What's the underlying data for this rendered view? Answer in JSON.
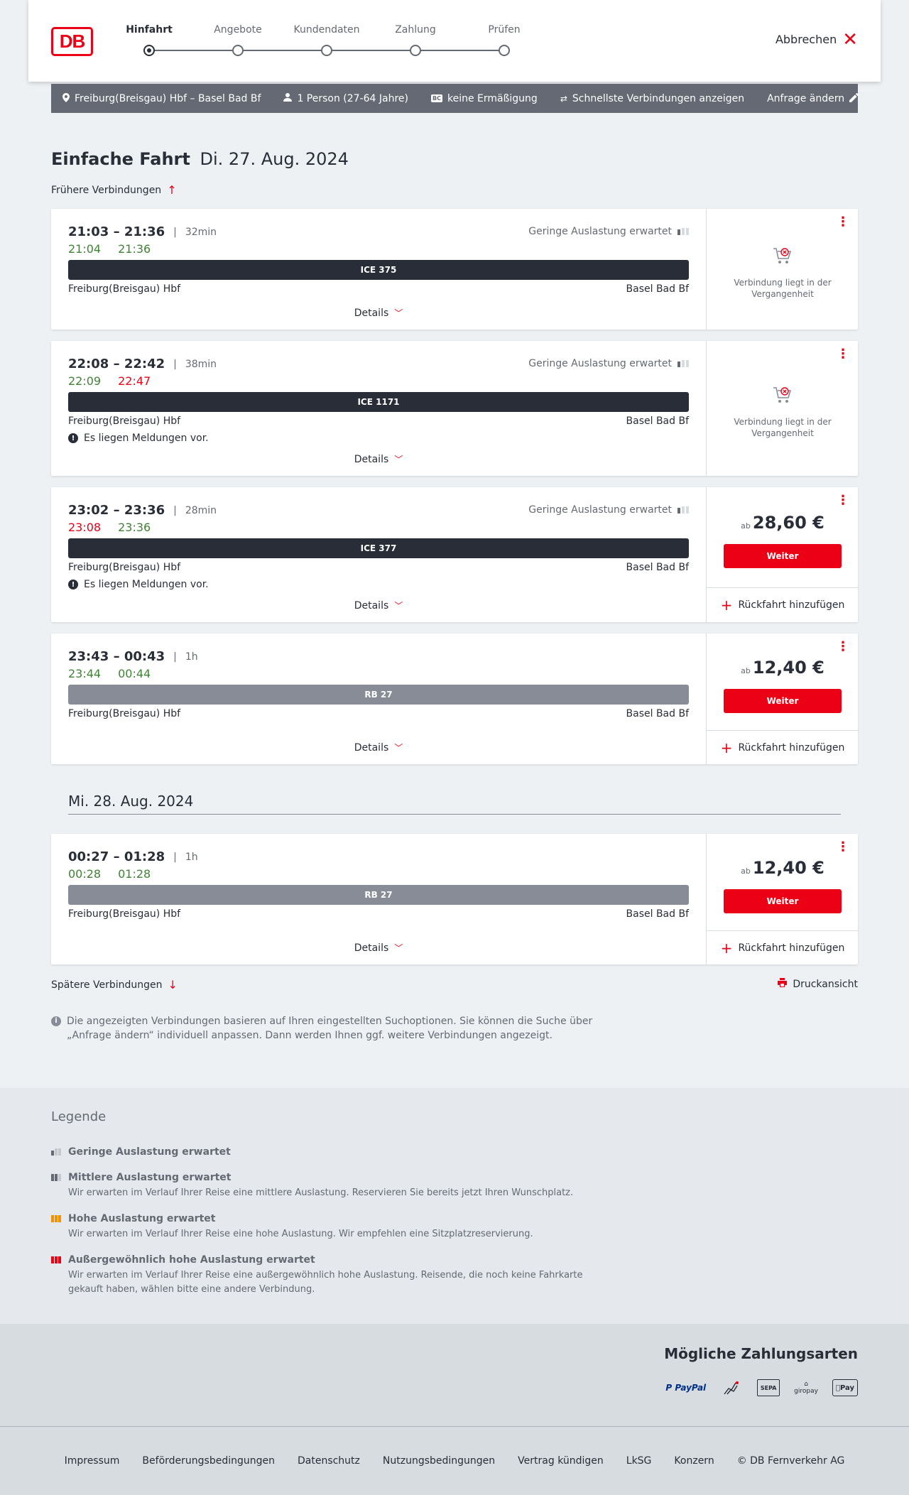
{
  "header": {
    "logo_text": "DB",
    "steps": [
      {
        "label": "Hinfahrt",
        "active": true
      },
      {
        "label": "Angebote",
        "active": false
      },
      {
        "label": "Kundendaten",
        "active": false
      },
      {
        "label": "Zahlung",
        "active": false
      },
      {
        "label": "Prüfen",
        "active": false
      }
    ],
    "cancel_label": "Abbrechen"
  },
  "searchbar": {
    "route": "Freiburg(Breisgau) Hbf – Basel Bad Bf",
    "travellers": "1 Person (27-64 Jahre)",
    "discount": "keine Ermäßigung",
    "fastest": "Schnellste Verbindungen anzeigen",
    "edit": "Anfrage ändern",
    "discount_badge": "BC"
  },
  "page": {
    "title_bold": "Einfache Fahrt",
    "title_date": "Di. 27. Aug. 2024",
    "earlier": "Frühere Verbindungen",
    "later": "Spätere Verbindungen",
    "print": "Druckansicht",
    "day2": "Mi. 28. Aug. 2024",
    "info_note": "Die angezeigten Verbindungen basieren auf Ihren eingestellten Suchoptionen. Sie können die Suche über „Anfrage ändern“ individuell anpassen. Dann werden Ihnen ggf. weitere Verbindungen angezeigt."
  },
  "common": {
    "load_low": "Geringe Auslastung erwartet",
    "details": "Details",
    "messages": "Es liegen Meldungen vor.",
    "past": "Verbindung liegt in der Vergangenheit",
    "ab": "ab",
    "weiter": "Weiter",
    "return": "Rückfahrt hinzufügen",
    "from": "Freiburg(Breisgau) Hbf",
    "to": "Basel Bad Bf"
  },
  "connections": [
    {
      "times": "21:03 – 21:36",
      "duration": "32min",
      "rt_dep": "21:04",
      "rt_arr": "21:36",
      "train": "ICE 375"
    },
    {
      "times": "22:08 – 22:42",
      "duration": "38min",
      "rt_dep": "22:09",
      "rt_arr": "22:47",
      "train": "ICE 1171"
    },
    {
      "times": "23:02 – 23:36",
      "duration": "28min",
      "rt_dep": "23:08",
      "rt_arr": "23:36",
      "train": "ICE 377",
      "price": "28,60 €"
    },
    {
      "times": "23:43 – 00:43",
      "duration": "1h",
      "rt_dep": "23:44",
      "rt_arr": "00:44",
      "train": "RB 27",
      "price": "12,40 €"
    },
    {
      "times": "00:27 – 01:28",
      "duration": "1h",
      "rt_dep": "00:28",
      "rt_arr": "01:28",
      "train": "RB 27",
      "price": "12,40 €"
    }
  ],
  "legend": {
    "title": "Legende",
    "items": [
      {
        "title": "Geringe Auslastung erwartet",
        "desc": ""
      },
      {
        "title": "Mittlere Auslastung erwartet",
        "desc": "Wir erwarten im Verlauf Ihrer Reise eine mittlere Auslastung. Reservieren Sie bereits jetzt Ihren Wunschplatz."
      },
      {
        "title": "Hohe Auslastung erwartet",
        "desc": "Wir erwarten im Verlauf Ihrer Reise eine hohe Auslastung. Wir empfehlen eine Sitzplatzreservierung."
      },
      {
        "title": "Außergewöhnlich hohe Auslastung erwartet",
        "desc": "Wir erwarten im Verlauf Ihrer Reise eine außergewöhnlich hohe Auslastung. Reisende, die noch keine Fahrkarte gekauft haben, wählen bitte eine andere Verbindung."
      }
    ]
  },
  "payment": {
    "title": "Mögliche Zahlungsarten",
    "paypal": "PayPal",
    "sepa": "SEPA",
    "giropay": "giropay",
    "applepay": "Pay"
  },
  "footer": {
    "links": [
      "Impressum",
      "Beförderungsbedingungen",
      "Datenschutz",
      "Nutzungsbedingungen",
      "Vertrag kündigen",
      "LkSG",
      "Konzern"
    ],
    "copyright": "© DB Fernverkehr AG"
  }
}
